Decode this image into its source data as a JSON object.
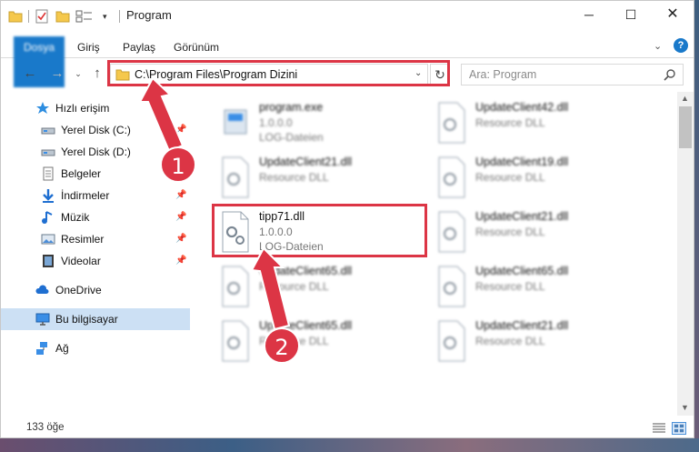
{
  "window": {
    "title": "Program",
    "minimize_glyph": "─",
    "maximize_glyph": "☐",
    "close_glyph": "✕"
  },
  "quick_access": {
    "dropdown_glyph": "▾"
  },
  "ribbon": {
    "tabs": [
      "Dosya",
      "Giriş",
      "Paylaş",
      "Görünüm"
    ],
    "expand_glyph": "⌄",
    "help_glyph": "?"
  },
  "nav": {
    "back_glyph": "←",
    "forward_glyph": "→",
    "recent_glyph": "⌄",
    "up_glyph": "↑",
    "address": "C:\\Program Files\\Program Dizini",
    "address_drop_glyph": "⌄",
    "refresh_glyph": "↻",
    "search_placeholder": "Ara: Program"
  },
  "sidebar": {
    "items": [
      {
        "label": "Hızlı erişim",
        "icon": "star-icon"
      },
      {
        "label": "Yerel Disk (C:)",
        "icon": "drive-icon",
        "pinned": true
      },
      {
        "label": "Yerel Disk (D:)",
        "icon": "drive-icon"
      },
      {
        "label": "Belgeler",
        "icon": "documents-icon"
      },
      {
        "label": "İndirmeler",
        "icon": "downloads-icon",
        "pinned": true
      },
      {
        "label": "Müzik",
        "icon": "music-icon",
        "pinned": true
      },
      {
        "label": "Resimler",
        "icon": "pictures-icon",
        "pinned": true
      },
      {
        "label": "Videolar",
        "icon": "videos-icon",
        "pinned": true
      },
      {
        "label": "OneDrive",
        "icon": "cloud-icon"
      },
      {
        "label": "Bu bilgisayar",
        "icon": "computer-icon",
        "selected": true
      },
      {
        "label": "Ağ",
        "icon": "network-icon"
      }
    ],
    "pin_glyph": "📌"
  },
  "files": [
    {
      "name": "program.exe",
      "line2": "1.0.0.0",
      "line3": "LOG-Dateien",
      "icon": "exe-icon"
    },
    {
      "name": "UpdateClient42.dll",
      "line2": "Resource DLL",
      "line3": "",
      "icon": "dll-icon"
    },
    {
      "name": "UpdateClient21.dll",
      "line2": "Resource DLL",
      "line3": "",
      "icon": "dll-icon"
    },
    {
      "name": "UpdateClient19.dll",
      "line2": "Resource DLL",
      "line3": "",
      "icon": "dll-icon"
    },
    {
      "name": "tipp71.dll",
      "line2": "1.0.0.0",
      "line3": "LOG-Dateien",
      "icon": "dll-icon",
      "highlighted": true
    },
    {
      "name": "UpdateClient21.dll",
      "line2": "Resource DLL",
      "line3": "",
      "icon": "dll-icon"
    },
    {
      "name": "UpdateClient65.dll",
      "line2": "Resource DLL",
      "line3": "",
      "icon": "dll-icon"
    },
    {
      "name": "UpdateClient65.dll",
      "line2": "Resource DLL",
      "line3": "",
      "icon": "dll-icon"
    },
    {
      "name": "UpdateClient65.dll",
      "line2": "Resource DLL",
      "line3": "",
      "icon": "dll-icon"
    },
    {
      "name": "UpdateClient21.dll",
      "line2": "Resource DLL",
      "line3": "",
      "icon": "dll-icon"
    }
  ],
  "status": {
    "item_count": "133 öğe"
  },
  "annotations": {
    "step1": "1",
    "step2": "2",
    "color": "#dc3545"
  }
}
